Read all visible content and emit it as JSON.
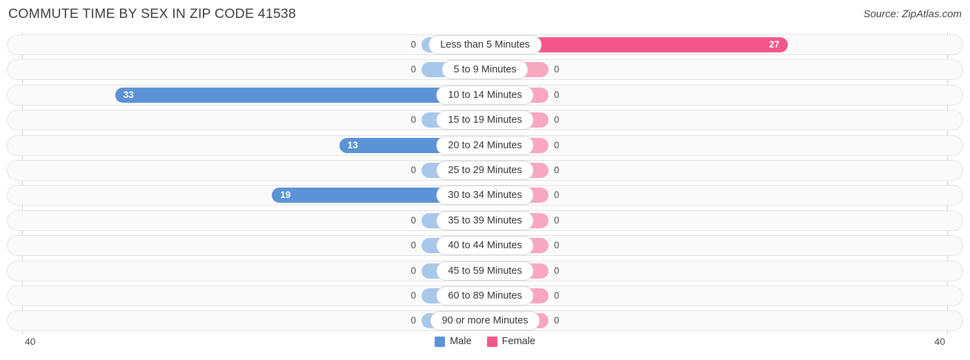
{
  "header": {
    "title": "COMMUTE TIME BY SEX IN ZIP CODE 41538",
    "source": "Source: ZipAtlas.com"
  },
  "legend": {
    "male_label": "Male",
    "female_label": "Female",
    "male_color": "#5b93d6",
    "female_color": "#f2578b"
  },
  "axis": {
    "left_tick": "40",
    "right_tick": "40"
  },
  "rows": [
    {
      "label": "Less than 5 Minutes",
      "male": "0",
      "female": "27"
    },
    {
      "label": "5 to 9 Minutes",
      "male": "0",
      "female": "0"
    },
    {
      "label": "10 to 14 Minutes",
      "male": "33",
      "female": "0"
    },
    {
      "label": "15 to 19 Minutes",
      "male": "0",
      "female": "0"
    },
    {
      "label": "20 to 24 Minutes",
      "male": "13",
      "female": "0"
    },
    {
      "label": "25 to 29 Minutes",
      "male": "0",
      "female": "0"
    },
    {
      "label": "30 to 34 Minutes",
      "male": "19",
      "female": "0"
    },
    {
      "label": "35 to 39 Minutes",
      "male": "0",
      "female": "0"
    },
    {
      "label": "40 to 44 Minutes",
      "male": "0",
      "female": "0"
    },
    {
      "label": "45 to 59 Minutes",
      "male": "0",
      "female": "0"
    },
    {
      "label": "60 to 89 Minutes",
      "male": "0",
      "female": "0"
    },
    {
      "label": "90 or more Minutes",
      "male": "0",
      "female": "0"
    }
  ],
  "chart_data": {
    "type": "bar",
    "title": "COMMUTE TIME BY SEX IN ZIP CODE 41538",
    "subtitle": "Source: ZipAtlas.com",
    "orientation": "horizontal-diverging",
    "xlabel": "",
    "ylabel": "",
    "xlim": [
      40,
      40
    ],
    "axis_left_max": 40,
    "axis_right_max": 40,
    "grid": false,
    "legend_position": "bottom-center",
    "categories": [
      "Less than 5 Minutes",
      "5 to 9 Minutes",
      "10 to 14 Minutes",
      "15 to 19 Minutes",
      "20 to 24 Minutes",
      "25 to 29 Minutes",
      "30 to 34 Minutes",
      "35 to 39 Minutes",
      "40 to 44 Minutes",
      "45 to 59 Minutes",
      "60 to 89 Minutes",
      "90 or more Minutes"
    ],
    "series": [
      {
        "name": "Male",
        "color": "#5b93d6",
        "direction": "left",
        "values": [
          0,
          0,
          33,
          0,
          13,
          0,
          19,
          0,
          0,
          0,
          0,
          0
        ]
      },
      {
        "name": "Female",
        "color": "#f2578b",
        "direction": "right",
        "values": [
          27,
          0,
          0,
          0,
          0,
          0,
          0,
          0,
          0,
          0,
          0,
          0
        ]
      }
    ]
  }
}
